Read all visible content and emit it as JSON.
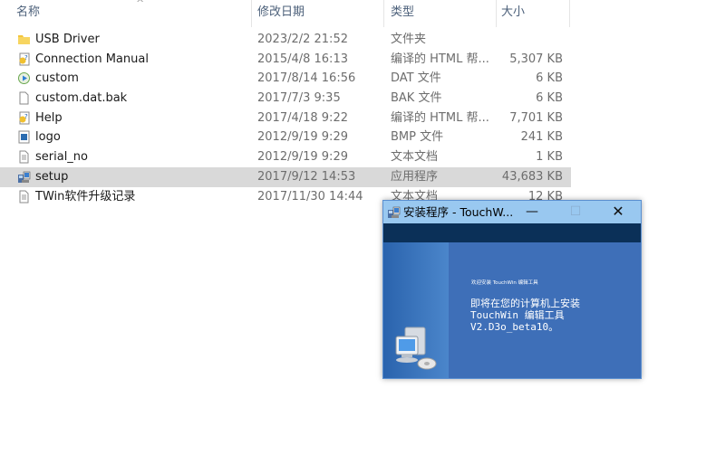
{
  "columns": {
    "name": "名称",
    "date": "修改日期",
    "type": "类型",
    "size": "大小"
  },
  "files": [
    {
      "name": "USB Driver",
      "date": "2023/2/2 21:52",
      "type": "文件夹",
      "size": "",
      "icon": "folder-icon"
    },
    {
      "name": "Connection Manual",
      "date": "2015/4/8 16:13",
      "type": "编译的 HTML 帮...",
      "size": "5,307 KB",
      "icon": "help-file-icon"
    },
    {
      "name": "custom",
      "date": "2017/8/14 16:56",
      "type": "DAT 文件",
      "size": "6 KB",
      "icon": "dat-file-icon"
    },
    {
      "name": "custom.dat.bak",
      "date": "2017/7/3 9:35",
      "type": "BAK 文件",
      "size": "6 KB",
      "icon": "blank-file-icon"
    },
    {
      "name": "Help",
      "date": "2017/4/18 9:22",
      "type": "编译的 HTML 帮...",
      "size": "7,701 KB",
      "icon": "help-file-icon"
    },
    {
      "name": "logo",
      "date": "2012/9/19 9:29",
      "type": "BMP 文件",
      "size": "241 KB",
      "icon": "bmp-file-icon"
    },
    {
      "name": "serial_no",
      "date": "2012/9/19 9:29",
      "type": "文本文档",
      "size": "1 KB",
      "icon": "text-file-icon"
    },
    {
      "name": "setup",
      "date": "2017/9/12 14:53",
      "type": "应用程序",
      "size": "43,683 KB",
      "icon": "setup-exe-icon"
    },
    {
      "name": "TWin软件升级记录",
      "date": "2017/11/30 14:44",
      "type": "文本文档",
      "size": "12 KB",
      "icon": "text-file-icon"
    }
  ],
  "selected_row": 7,
  "installer": {
    "title": "安装程序 - TouchW...",
    "small_text": "欢迎安装 TouchWin 编辑工具",
    "message": "即将在您的计算机上安装\nTouchWin 编辑工具\nV2.D3o_beta10。"
  },
  "colors": {
    "selection": "#d9d9d9",
    "titlebar": "#99c8f0",
    "installer_body": "#3e6fb8",
    "navbar": "#0b3058"
  }
}
